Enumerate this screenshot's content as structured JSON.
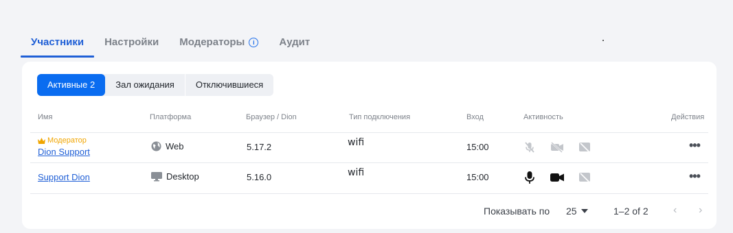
{
  "tabs": [
    {
      "label": "Участники"
    },
    {
      "label": "Настройки"
    },
    {
      "label": "Модераторы"
    },
    {
      "label": "Аудит"
    }
  ],
  "info_icon_glyph": "i",
  "segments": [
    {
      "label": "Активные 2"
    },
    {
      "label": "Зал ожидания"
    },
    {
      "label": "Отключившиеся"
    }
  ],
  "table": {
    "headers": {
      "name": "Имя",
      "platform": "Платформа",
      "browser": "Браузер / Dion",
      "connection": "Тип подключения",
      "joined": "Вход",
      "activity": "Активность",
      "actions": "Действия"
    },
    "rows": [
      {
        "role": "Модератор",
        "name": "Dion Support",
        "platform": "Web",
        "platform_icon": "globe-icon",
        "version": "5.17.2",
        "connection": "wifi",
        "joined": "15:00",
        "mic": "off",
        "camera": "off",
        "screen": "off",
        "more": "•••"
      },
      {
        "role": "",
        "name": "Support Dion",
        "platform": "Desktop",
        "platform_icon": "monitor-icon",
        "version": "5.16.0",
        "connection": "wifi",
        "joined": "15:00",
        "mic": "on",
        "camera": "on",
        "screen": "off",
        "more": "•••"
      }
    ]
  },
  "pagination": {
    "rows_per_page_label": "Показывать по",
    "rows_per_page": "25",
    "range": "1–2 of 2",
    "prev": "‹",
    "next": "›"
  },
  "colors": {
    "accent": "#1f5fd6",
    "moderator": "#f0a500"
  }
}
